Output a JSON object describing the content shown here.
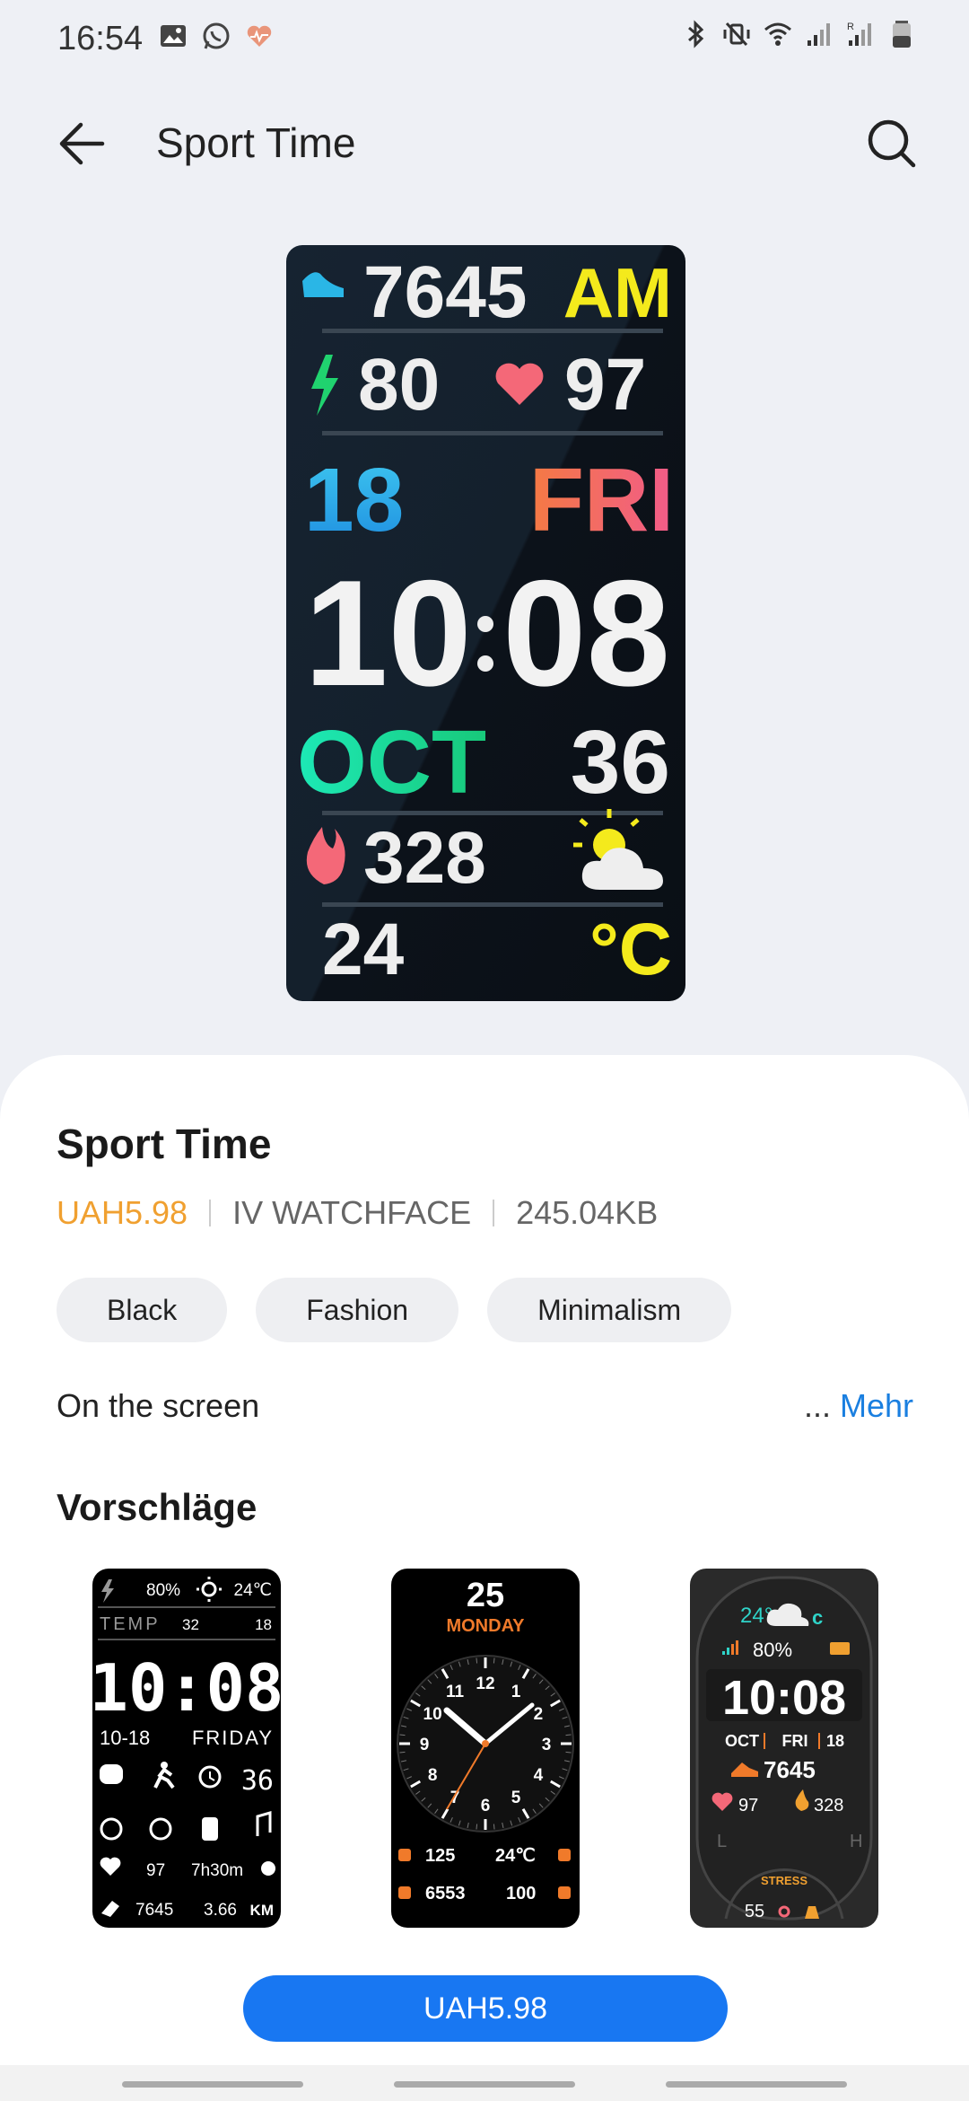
{
  "status_bar": {
    "time": "16:54",
    "left_icons": [
      "gallery-icon",
      "whatsapp-icon",
      "health-heart-icon"
    ],
    "right_icons": [
      "bluetooth-icon",
      "vibrate-mute-icon",
      "wifi-icon",
      "signal-icon",
      "signal-roaming-icon",
      "battery-icon"
    ],
    "roaming_label": "R"
  },
  "header": {
    "title": "Sport Time",
    "back_icon": "arrow-left-icon",
    "search_icon": "search-icon"
  },
  "hero_face": {
    "steps": "7645",
    "ampm": "AM",
    "battery": "80",
    "heart": "97",
    "day_num": "18",
    "weekday": "FRI",
    "hour": "10",
    "minute": "08",
    "month": "OCT",
    "week_num": "36",
    "calories": "328",
    "temp": "24",
    "temp_unit": "°C"
  },
  "product": {
    "title": "Sport Time",
    "price": "UAH5.98",
    "vendor": "IV WATCHFACE",
    "size": "245.04KB",
    "tags": [
      "Black",
      "Fashion",
      "Minimalism"
    ],
    "description": "On the screen",
    "more_dots": "...",
    "more_label": "Mehr"
  },
  "suggestions": {
    "title": "Vorschläge",
    "face1": {
      "battery": "80%",
      "temp": "24℃",
      "temp_label": "TEMP",
      "temp_high": "32",
      "temp_low": "18",
      "time": "10:08",
      "date": "10-18",
      "weekday": "FRIDAY",
      "week": "36",
      "heart": "97",
      "sleep": "7h30m",
      "steps": "7645",
      "distance": "3.66",
      "distance_unit": "KM"
    },
    "face2": {
      "day": "25",
      "weekday": "MONDAY",
      "dial": [
        "12",
        "1",
        "2",
        "3",
        "4",
        "5",
        "6",
        "7",
        "8",
        "9",
        "10",
        "11"
      ],
      "heart": "125",
      "temp": "24℃",
      "steps": "6553",
      "battery": "100",
      "accent": "#f07a2a"
    },
    "face3": {
      "temp": "24°",
      "temp_unit": "c",
      "battery": "80%",
      "time": "10:08",
      "month": "OCT",
      "weekday": "FRI",
      "day": "18",
      "steps": "7645",
      "heart": "97",
      "calories": "328",
      "low": "L",
      "high": "H",
      "stress_label": "STRESS",
      "stress": "55"
    }
  },
  "buy_button": {
    "label": "UAH5.98"
  },
  "colors": {
    "accent_blue": "#1877f2",
    "price_orange": "#f0a030",
    "link_blue": "#1a7fe0"
  }
}
